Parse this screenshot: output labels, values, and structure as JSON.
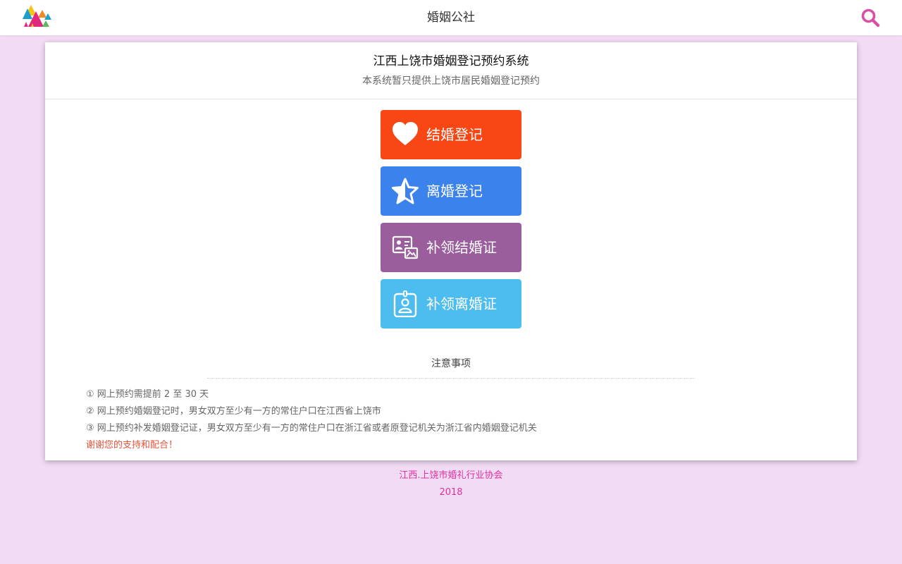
{
  "header": {
    "app_title": "婚姻公社",
    "search_icon": "search-icon",
    "accent_color": "#d94fa3"
  },
  "card": {
    "title": "江西上饶市婚姻登记预约系统",
    "subtitle": "本系统暂只提供上饶市居民婚姻登记预约"
  },
  "actions": [
    {
      "label": "结婚登记",
      "icon": "heart-icon",
      "color": "#f84615"
    },
    {
      "label": "离婚登记",
      "icon": "star-outline-icon",
      "color": "#3c82ec"
    },
    {
      "label": "补领结婚证",
      "icon": "id-card-photo-icon",
      "color": "#9b5e9d"
    },
    {
      "label": "补领离婚证",
      "icon": "id-badge-icon",
      "color": "#4dbcee"
    }
  ],
  "notice": {
    "title": "注意事项",
    "items": [
      "① 网上预约需提前 2 至 30 天",
      "② 网上预约婚姻登记时，男女双方至少有一方的常住户口在江西省上饶市",
      "③ 网上预约补发婚姻登记证，男女双方至少有一方的常住户口在浙江省或者原登记机关为浙江省内婚姻登记机关"
    ],
    "thanks": "谢谢您的支持和配合！",
    "thanks_color": "#e8533b"
  },
  "footer": {
    "org": "江西.上饶市婚礼行业协会",
    "year": "2018",
    "color": "#e0339b"
  },
  "colors": {
    "page_background": "#f2dbf4"
  }
}
